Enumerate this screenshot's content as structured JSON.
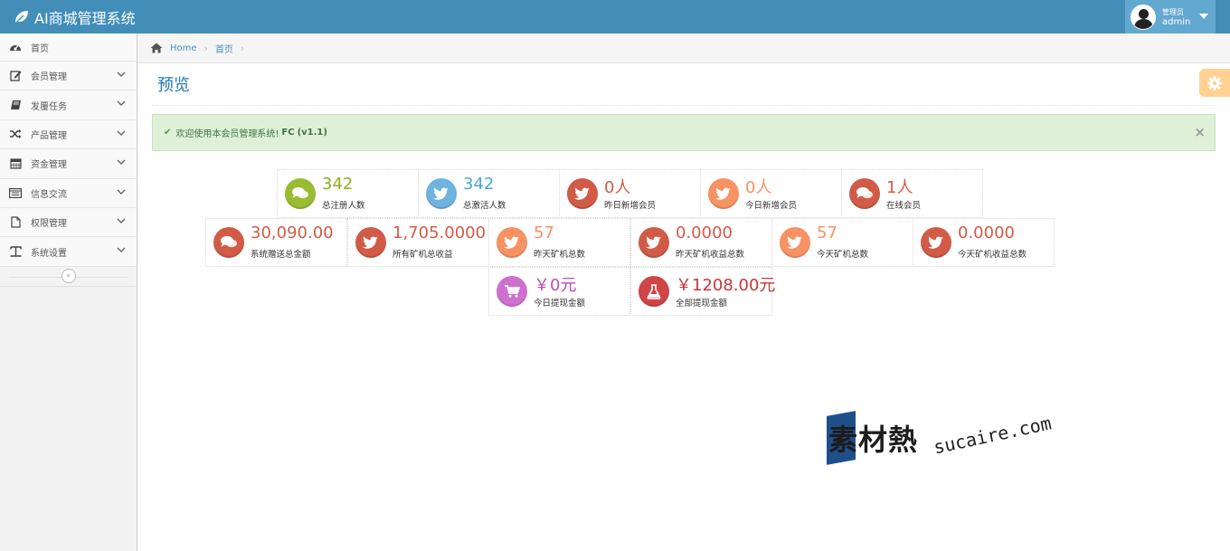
{
  "app": {
    "title": "AI商城管理系统"
  },
  "user": {
    "role": "管理员",
    "name": "admin"
  },
  "sidebar": {
    "items": [
      {
        "label": "首页",
        "icon": "dashboard-icon"
      },
      {
        "label": "会员管理",
        "icon": "edit-icon"
      },
      {
        "label": "发覆任务",
        "icon": "book-icon"
      },
      {
        "label": "产品管理",
        "icon": "shuffle-icon"
      },
      {
        "label": "资金管理",
        "icon": "calendar-icon"
      },
      {
        "label": "信息交流",
        "icon": "list-icon"
      },
      {
        "label": "权限管理",
        "icon": "file-icon"
      },
      {
        "label": "系统设置",
        "icon": "text-icon"
      }
    ],
    "collapse_glyph": "«"
  },
  "breadcrumb": {
    "home": "Home",
    "current": "首页",
    "sep": "›"
  },
  "page": {
    "title": "预览"
  },
  "alert": {
    "text": "欢迎使用本会员管理系统!",
    "bold": "FC",
    "version": "(v1.1)",
    "close": "×"
  },
  "stats": [
    {
      "value": "342",
      "label": "总注册人数",
      "color": "#9abc32",
      "icon": "comments-icon"
    },
    {
      "value": "342",
      "label": "总激活人数",
      "color": "#6fb3e0",
      "icon": "twitter-icon"
    },
    {
      "value": "0人",
      "label": "昨日新增会员",
      "color": "#d15b47",
      "icon": "twitter-icon"
    },
    {
      "value": "0人",
      "label": "今日新增会员",
      "color": "#f79263",
      "icon": "twitter-icon"
    },
    {
      "value": "1人",
      "label": "在线会员",
      "color": "#d15b47",
      "icon": "comments-icon"
    },
    {
      "value": "30,090.00",
      "label": "系统赠送总金额",
      "color": "#d15b47",
      "icon": "comments-icon"
    },
    {
      "value": "1,705.0000",
      "label": "所有矿机总收益",
      "color": "#d15b47",
      "icon": "twitter-icon"
    },
    {
      "value": "57",
      "label": "昨天矿机总数",
      "color": "#f79263",
      "icon": "twitter-icon"
    },
    {
      "value": "0.0000",
      "label": "昨天矿机收益总数",
      "color": "#d15b47",
      "icon": "twitter-icon"
    },
    {
      "value": "57",
      "label": "今天矿机总数",
      "color": "#f79263",
      "icon": "twitter-icon"
    },
    {
      "value": "0.0000",
      "label": "今天矿机收益总数",
      "color": "#d15b47",
      "icon": "twitter-icon"
    },
    {
      "value": "￥0元",
      "label": "今日提现金额",
      "color": "#cf6fce",
      "icon": "cart-icon"
    },
    {
      "value": "￥1208.00元",
      "label": "全部提现金额",
      "color": "#d04545",
      "icon": "flask-icon"
    }
  ],
  "watermark": {
    "cn": "素材熱",
    "en": "sucaire.com"
  }
}
